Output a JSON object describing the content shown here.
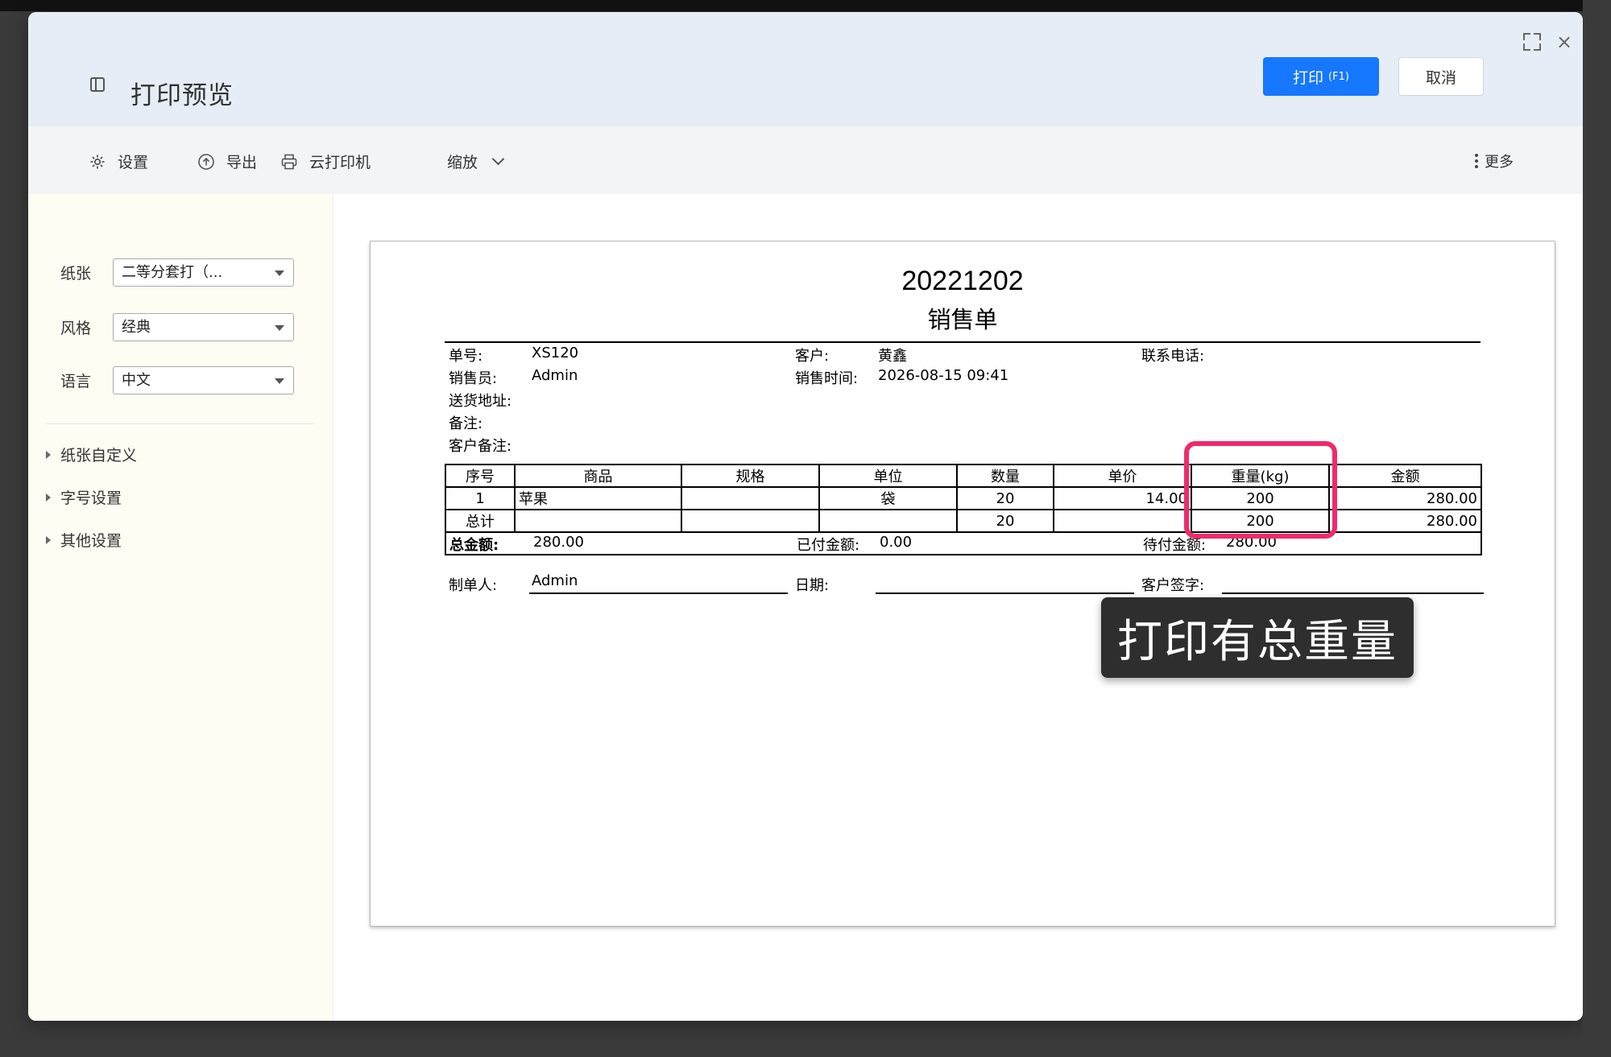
{
  "window": {
    "title": "打印预览",
    "print_button": "打印",
    "print_shortcut": "(F1)",
    "cancel_button": "取消"
  },
  "toolbar": {
    "settings": "设置",
    "export": "导出",
    "cloud_printer": "云打印机",
    "zoom": "缩放",
    "more": "更多"
  },
  "sidebar": {
    "paper_label": "纸张",
    "paper_value": "二等分套打（...",
    "style_label": "风格",
    "style_value": "经典",
    "language_label": "语言",
    "language_value": "中文",
    "sections": [
      "纸张自定义",
      "字号设置",
      "其他设置"
    ]
  },
  "document": {
    "code": "20221202",
    "title": "销售单",
    "order_no_label": "单号:",
    "order_no": "XS120",
    "customer_label": "客户:",
    "customer": "黄鑫",
    "phone_label": "联系电话:",
    "salesperson_label": "销售员:",
    "salesperson": "Admin",
    "sale_time_label": "销售时间:",
    "sale_time": "2026-08-15 09:41",
    "address_label": "送货地址:",
    "note_label": "备注:",
    "customer_note_label": "客户备注:",
    "table": {
      "headers": [
        "序号",
        "商品",
        "规格",
        "单位",
        "数量",
        "单价",
        "重量(kg)",
        "金额"
      ],
      "row": [
        "1",
        "苹果",
        "",
        "袋",
        "20",
        "14.00",
        "200",
        "280.00"
      ],
      "total": [
        "总计",
        "",
        "",
        "",
        "20",
        "",
        "200",
        "280.00"
      ]
    },
    "total_amount_label": "总金额:",
    "total_amount": "280.00",
    "paid_label": "已付金额:",
    "paid": "0.00",
    "unpaid_label": "待付金额:",
    "unpaid": "280.00",
    "maker_label": "制单人:",
    "maker": "Admin",
    "date_label": "日期:",
    "signature_label": "客户签字:"
  },
  "annotation": {
    "tag": "打印有总重量",
    "highlight_color": "#ee2b6c"
  },
  "colors": {
    "primary": "#1677ff",
    "header_bg": "#e6edf6",
    "sidebar_bg": "#fefdf3"
  }
}
